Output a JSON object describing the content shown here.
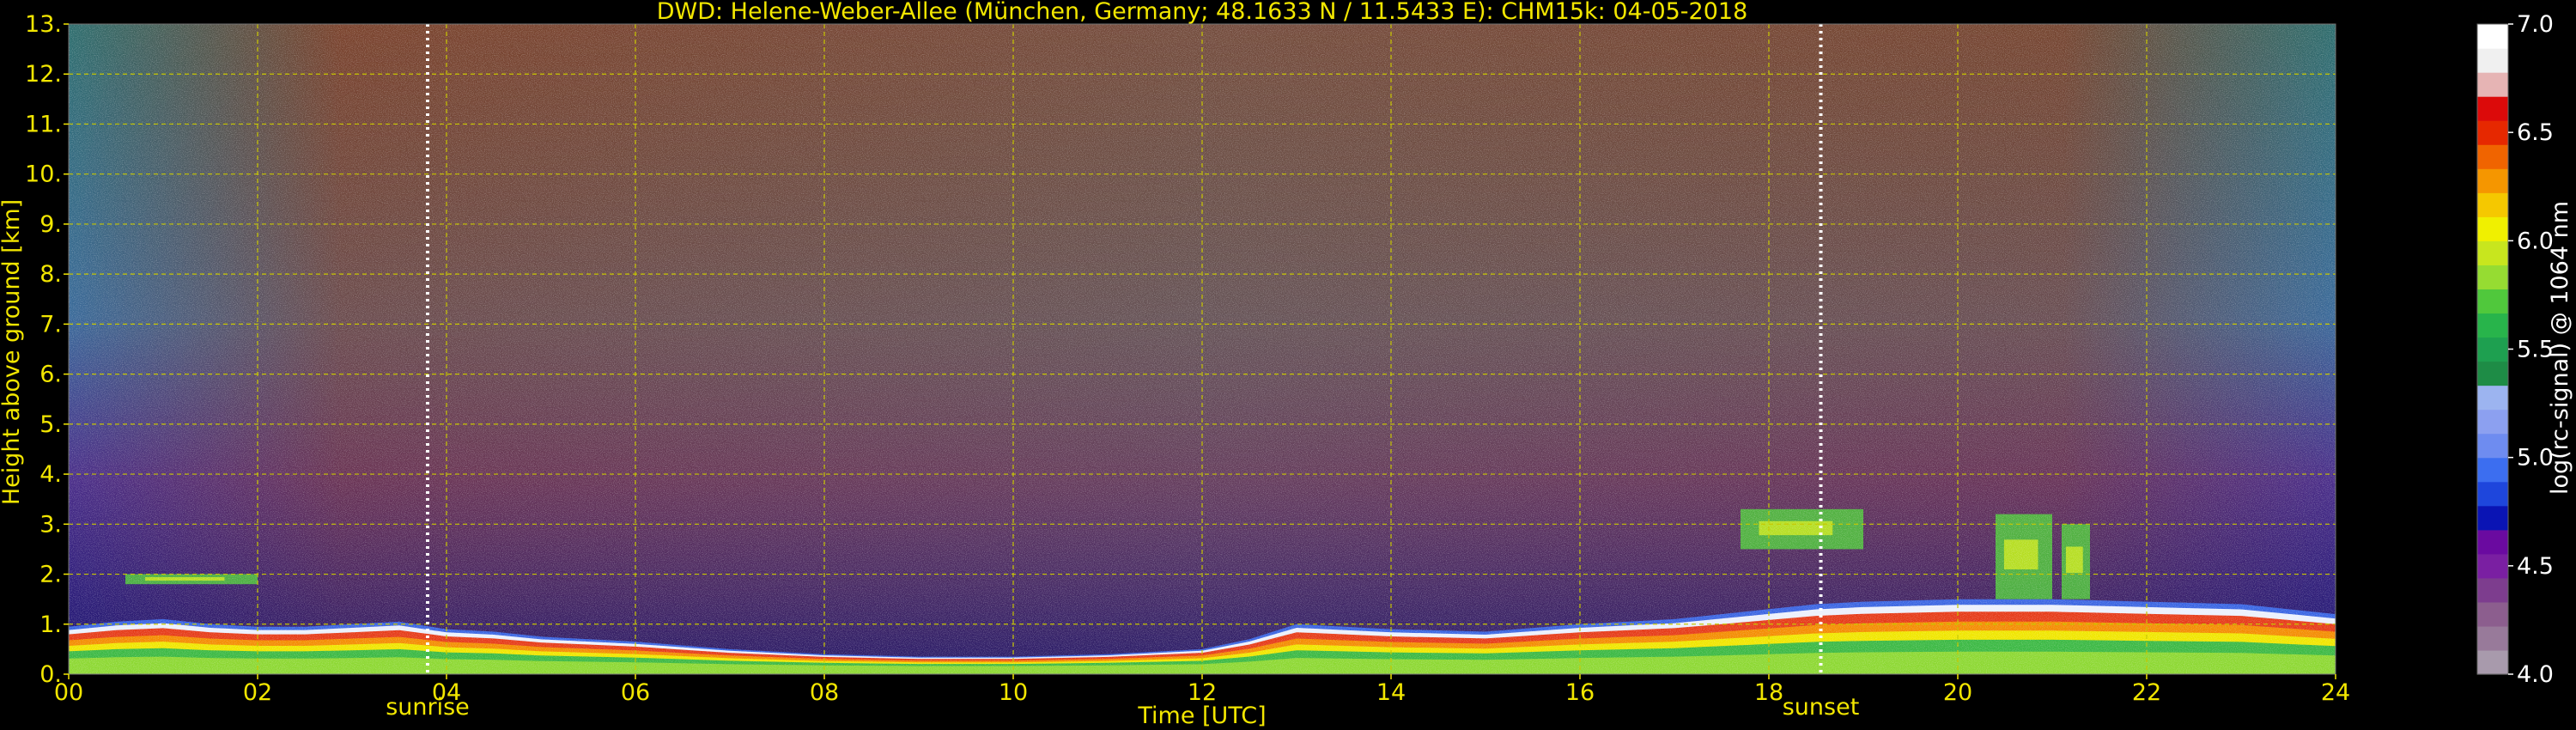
{
  "chart_data": {
    "type": "heatmap",
    "title": "DWD: Helene-Weber-Allee (München, Germany; 48.1633 N / 11.5433 E):    CHM15k: 04-05-2018",
    "xlabel": "Time [UTC]",
    "ylabel": "Height above ground [km]",
    "xlim": [
      0,
      24
    ],
    "ylim": [
      0,
      13
    ],
    "x_ticks": [
      "00",
      "02",
      "04",
      "06",
      "08",
      "10",
      "12",
      "14",
      "16",
      "18",
      "20",
      "22",
      "24"
    ],
    "y_ticks": [
      "0.",
      "1.",
      "2.",
      "3.",
      "4.",
      "5.",
      "6.",
      "7.",
      "8.",
      "9.",
      "10.",
      "11.",
      "12.",
      "13."
    ],
    "grid": true,
    "annotations": [
      {
        "text": "sunrise",
        "x": 3.8
      },
      {
        "text": "sunset",
        "x": 18.55
      }
    ],
    "colorbar": {
      "label": "log(rc-signal) @ 1064 nm",
      "range": [
        4.0,
        7.0
      ],
      "ticks": [
        "4.0",
        "4.5",
        "5.0",
        "5.5",
        "6.0",
        "6.5",
        "7.0"
      ],
      "colors": [
        "#a89aac",
        "#987a9a",
        "#8c5e8e",
        "#7d3d8e",
        "#7a1fa2",
        "#6a0aa0",
        "#0a14b4",
        "#1e46dc",
        "#3c6ef0",
        "#6e8cf0",
        "#8ca0f0",
        "#9cb4f0",
        "#1e8c46",
        "#1ea050",
        "#28b44b",
        "#50c83c",
        "#96dc32",
        "#c8e61e",
        "#f0f000",
        "#f5c800",
        "#f59600",
        "#f06400",
        "#e62800",
        "#dc0a0a",
        "#e6b4b4",
        "#f0f0f0",
        "#ffffff"
      ]
    },
    "series": [
      {
        "name": "aerosol layer top",
        "x": [
          0,
          0.5,
          1,
          1.5,
          2,
          2.5,
          3,
          3.5,
          4,
          4.5,
          5,
          6,
          7,
          8,
          9,
          10,
          11,
          12,
          12.5,
          13,
          14,
          15,
          16,
          17,
          17.5,
          18,
          18.5,
          19,
          20,
          21,
          22,
          23,
          24
        ],
        "values": [
          0.95,
          1.05,
          1.1,
          1.0,
          0.95,
          0.95,
          1.0,
          1.05,
          0.9,
          0.85,
          0.75,
          0.65,
          0.5,
          0.4,
          0.35,
          0.35,
          0.4,
          0.5,
          0.7,
          1.0,
          0.9,
          0.85,
          1.0,
          1.1,
          1.2,
          1.3,
          1.4,
          1.45,
          1.5,
          1.5,
          1.45,
          1.4,
          1.2
        ]
      }
    ],
    "cloud_layers": [
      {
        "x": [
          0.6,
          2.0
        ],
        "values": [
          1.8,
          2.0
        ]
      },
      {
        "x": [
          17.7,
          19.0
        ],
        "values": [
          2.5,
          3.3
        ]
      },
      {
        "x": [
          20.4,
          21.0
        ],
        "values": [
          1.5,
          3.2
        ]
      },
      {
        "x": [
          21.1,
          21.4
        ],
        "values": [
          1.5,
          3.0
        ]
      }
    ]
  }
}
